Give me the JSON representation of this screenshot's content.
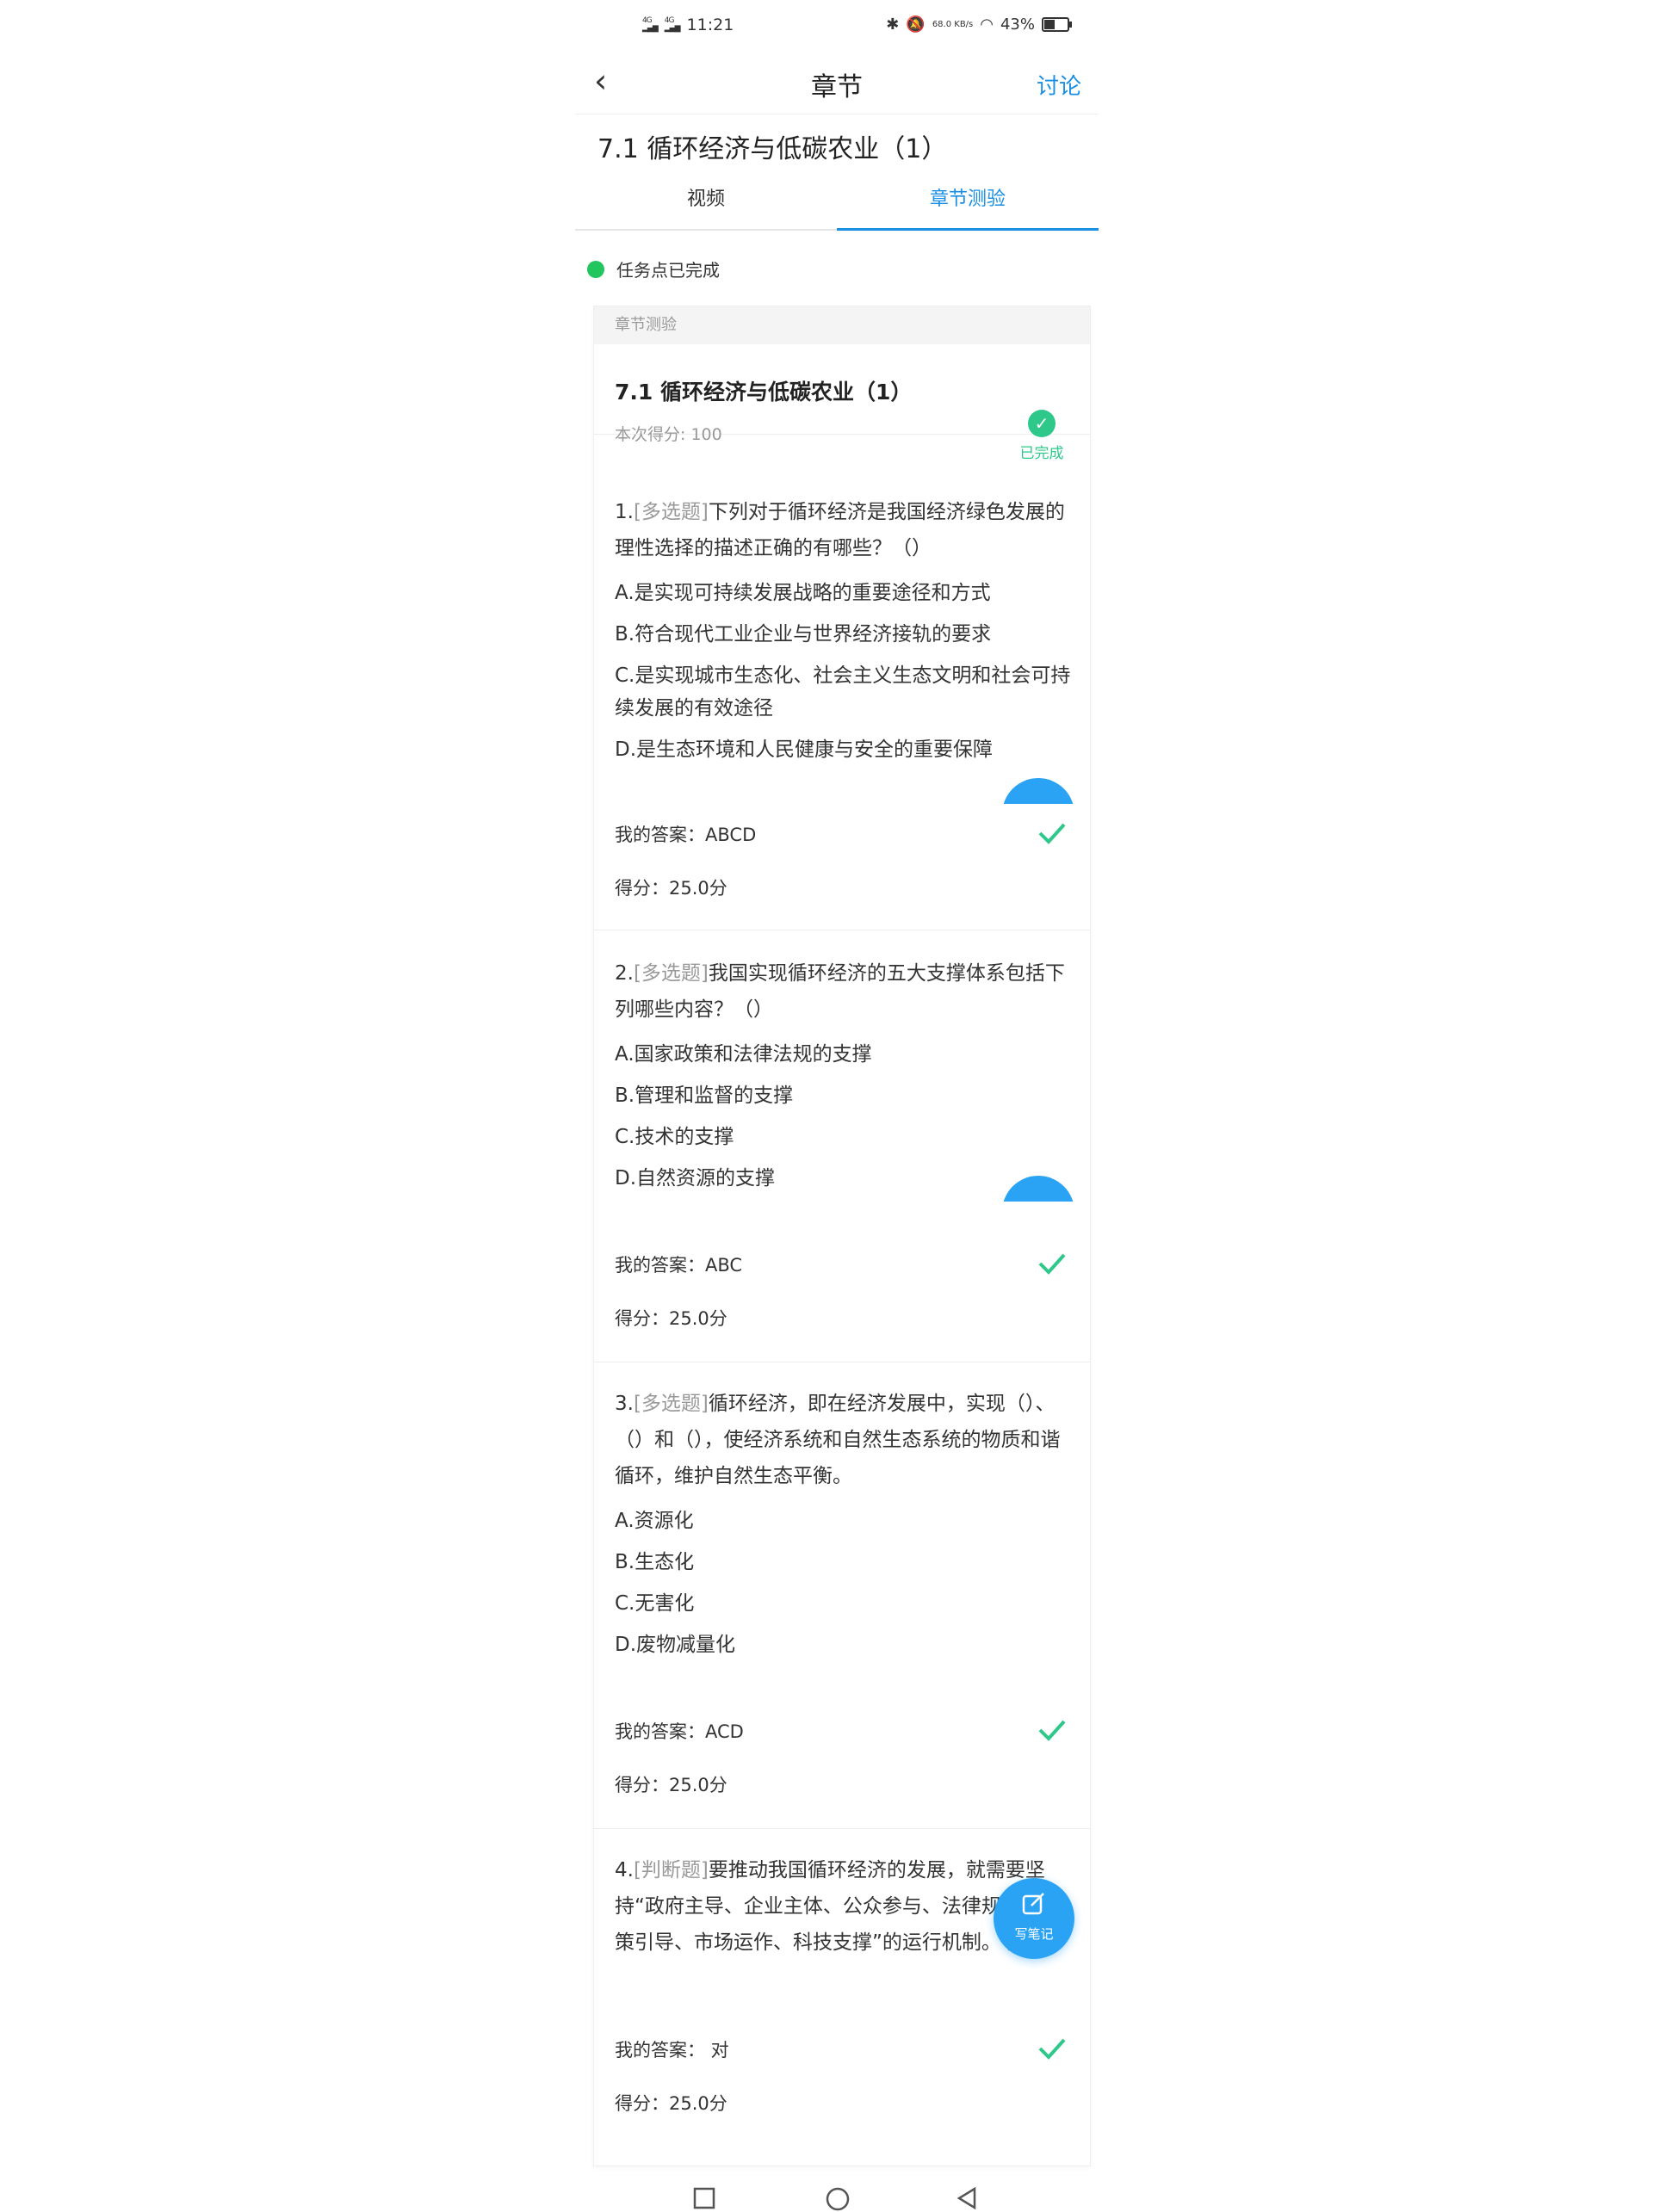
{
  "status_bar": {
    "network": "4G",
    "time": "11:21",
    "speed": "68.0 KB/s",
    "battery": "43%",
    "battery_level": 0.43
  },
  "nav": {
    "title": "章节",
    "discuss": "讨论"
  },
  "section_title": "7.1  循环经济与低碳农业（1）",
  "tabs": [
    {
      "label": "视频",
      "active": false
    },
    {
      "label": "章节测验",
      "active": true
    }
  ],
  "task_status": "任务点已完成",
  "card": {
    "header": "章节测验",
    "title": "7.1 循环经济与低碳农业（1）",
    "score_text": "本次得分: 100",
    "status": "已完成"
  },
  "questions": [
    {
      "num": "1.",
      "type": "[多选题]",
      "stem": "下列对于循环经济是我国经济绿色发展的理性选择的描述正确的有哪些？（）",
      "options": [
        "A.是实现可持续发展战略的重要途径和方式",
        "B.符合现代工业企业与世界经济接轨的要求",
        "C.是实现城市生态化、社会主义生态文明和社会可持续发展的有效途径",
        "D.是生态环境和人民健康与安全的重要保障"
      ],
      "answer": "我的答案：ABCD",
      "score": "得分：25.0分"
    },
    {
      "num": "2.",
      "type": "[多选题]",
      "stem": "我国实现循环经济的五大支撑体系包括下列哪些内容？（）",
      "options": [
        "A.国家政策和法律法规的支撑",
        "B.管理和监督的支撑",
        "C.技术的支撑",
        "D.自然资源的支撑"
      ],
      "answer": "我的答案：ABC",
      "score": "得分：25.0分"
    },
    {
      "num": "3.",
      "type": "[多选题]",
      "stem": "循环经济，即在经济发展中，实现（）、（）和（），使经济系统和自然生态系统的物质和谐循环，维护自然生态平衡。",
      "options": [
        "A.资源化",
        "B.生态化",
        "C.无害化",
        "D.废物减量化"
      ],
      "answer": "我的答案：ACD",
      "score": "得分：25.0分"
    },
    {
      "num": "4.",
      "type": "[判断题]",
      "stem": "要推动我国循环经济的发展，就需要坚持“政府主导、企业主体、公众参与、法律规范、政策引导、市场运作、科技支撑”的运行机制。（）",
      "options": [],
      "answer": "我的答案： 对",
      "score": "得分：25.0分"
    }
  ],
  "fab": {
    "label": "写笔记"
  },
  "colors": {
    "accent": "#1a8fe3",
    "success": "#2fc88b",
    "fab": "#2ba3f5"
  },
  "icons": [
    "back-arrow-icon",
    "check-icon",
    "edit-note-icon",
    "square-icon",
    "circle-icon",
    "triangle-back-icon"
  ]
}
